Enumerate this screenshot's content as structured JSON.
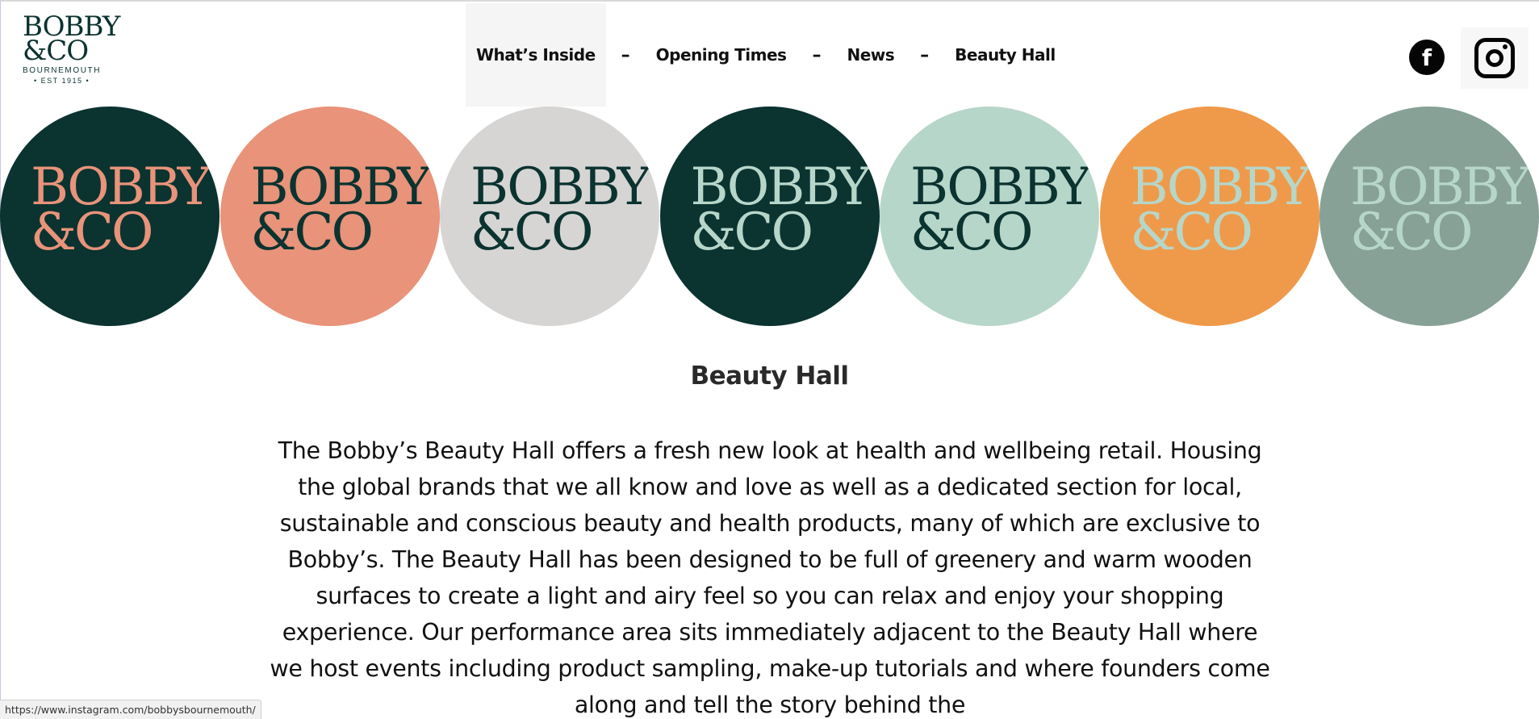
{
  "logo": {
    "line1": "BOBBY",
    "line2": "&CO",
    "sub": "BOURNEMOUTH",
    "est": "• EST 1915 •"
  },
  "nav": {
    "items": [
      {
        "label": "What’s Inside"
      },
      {
        "label": "Opening Times"
      },
      {
        "label": "News"
      },
      {
        "label": "Beauty Hall"
      }
    ],
    "separator": "–"
  },
  "social": {
    "facebook_glyph": "f",
    "facebook_icon": "facebook-icon",
    "instagram_icon": "instagram-icon"
  },
  "circles": [
    {
      "line1": "BOBBY",
      "line2": "&CO",
      "bg": "#0b3330",
      "fg": "#e8937a"
    },
    {
      "line1": "BOBBY",
      "line2": "&CO",
      "bg": "#e8937a",
      "fg": "#0b3330"
    },
    {
      "line1": "BOBBY",
      "line2": "&CO",
      "bg": "#d6d5d4",
      "fg": "#0b3330"
    },
    {
      "line1": "BOBBY",
      "line2": "&CO",
      "bg": "#0b3330",
      "fg": "#b7d6ca"
    },
    {
      "line1": "BOBBY",
      "line2": "&CO",
      "bg": "#b7d6ca",
      "fg": "#0b3330"
    },
    {
      "line1": "BOBBY",
      "line2": "&CO",
      "bg": "#ef9a4a",
      "fg": "#b7d6ca"
    },
    {
      "line1": "BOBBY",
      "line2": "&CO",
      "bg": "#87a197",
      "fg": "#b7d6ca"
    }
  ],
  "main": {
    "title": "Beauty Hall",
    "body": "The Bobby’s Beauty Hall offers a fresh new look at health and wellbeing retail. Housing the global brands that we all know and love as well as a dedicated section for local, sustainable and conscious beauty and health products, many of which are exclusive to Bobby’s. The Beauty Hall has been designed to be full of greenery and warm wooden surfaces to create a light and airy feel so you can relax and enjoy your shopping experience. Our performance area sits immediately adjacent to the Beauty Hall where we host events including product sampling, make-up tutorials and where founders come along and tell the story behind the"
  },
  "status_bar": {
    "url": "https://www.instagram.com/bobbysbournemouth/"
  }
}
